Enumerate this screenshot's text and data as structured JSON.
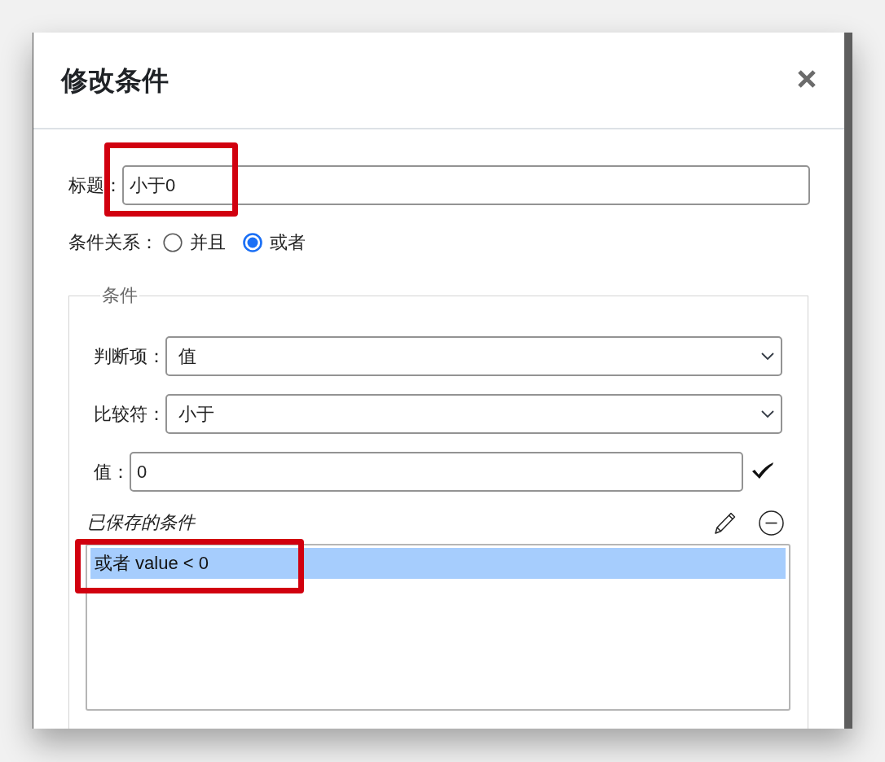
{
  "dialog": {
    "title": "修改条件"
  },
  "title_field": {
    "label": "标题：",
    "value": "小于0",
    "highlighted": true
  },
  "relation": {
    "label": "条件关系：",
    "options": [
      {
        "label": "并且",
        "selected": false
      },
      {
        "label": "或者",
        "selected": true
      }
    ]
  },
  "condition_group": {
    "legend": "条件",
    "fields": [
      {
        "kind": "select",
        "label": "判断项：",
        "value": "值"
      },
      {
        "kind": "select",
        "label": "比较符：",
        "value": "小于"
      },
      {
        "kind": "input",
        "label": "值：",
        "value": "0"
      }
    ]
  },
  "saved_conditions": {
    "heading": "已保存的条件",
    "items": [
      {
        "text": "或者 value < 0",
        "selected": true,
        "highlighted": true
      }
    ]
  }
}
